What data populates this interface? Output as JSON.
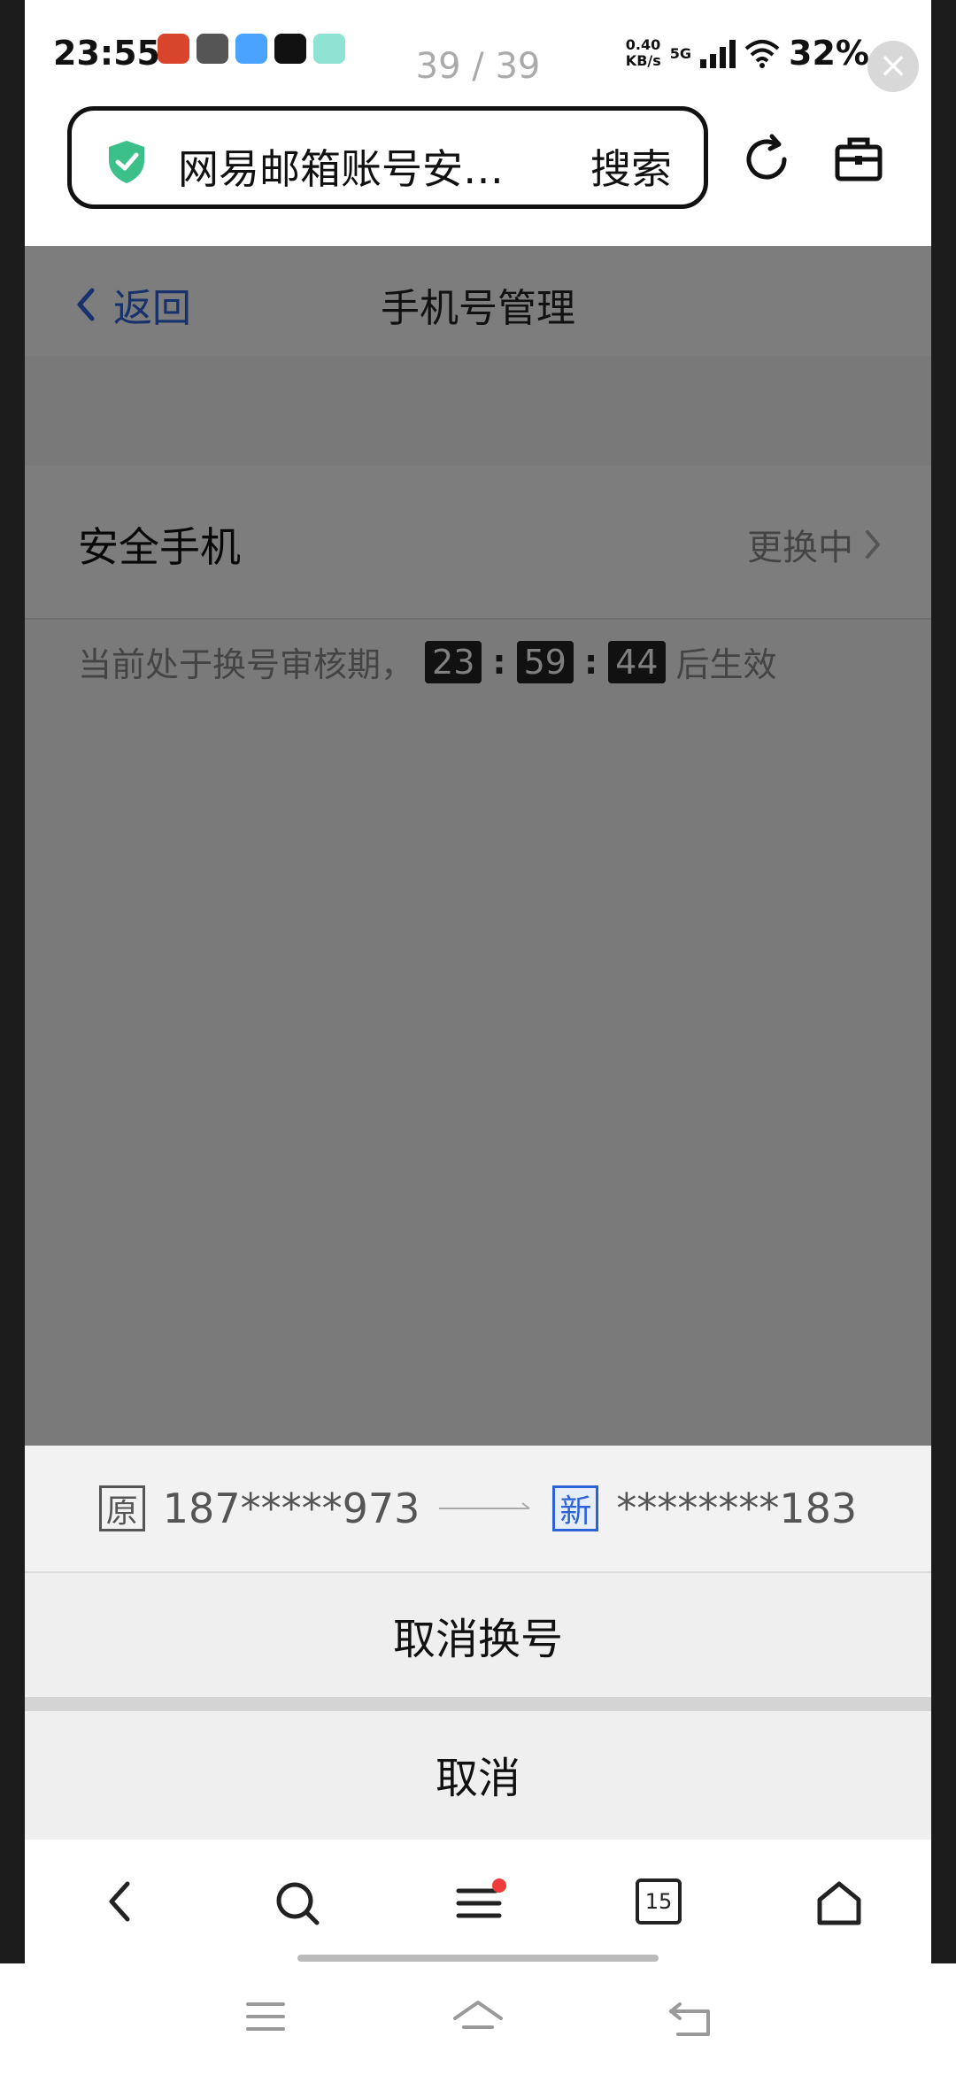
{
  "status_bar": {
    "time": "23:55",
    "page_counter": "39 / 39",
    "net_speed_top": "0.40",
    "net_speed_bottom": "KB/s",
    "network": "5G",
    "battery": "32%"
  },
  "browser": {
    "url_text": "网易邮箱账号安…",
    "search_label": "搜索"
  },
  "page": {
    "back_label": "返回",
    "title": "手机号管理",
    "row_label": "安全手机",
    "row_value": "更换中",
    "countdown_prefix": "当前处于换号审核期，",
    "countdown_hours": "23",
    "countdown_minutes": "59",
    "countdown_seconds": "44",
    "countdown_suffix": "后生效"
  },
  "sheet": {
    "old_tag": "原",
    "old_number": "187*****973",
    "new_tag": "新",
    "new_number": "********183",
    "cancel_swap_label": "取消换号",
    "cancel_label": "取消"
  },
  "toolbar": {
    "tabs_count": "15"
  },
  "colors": {
    "accent": "#2d62d6",
    "shield": "#3cc08a",
    "badge": "#f03b3b"
  }
}
